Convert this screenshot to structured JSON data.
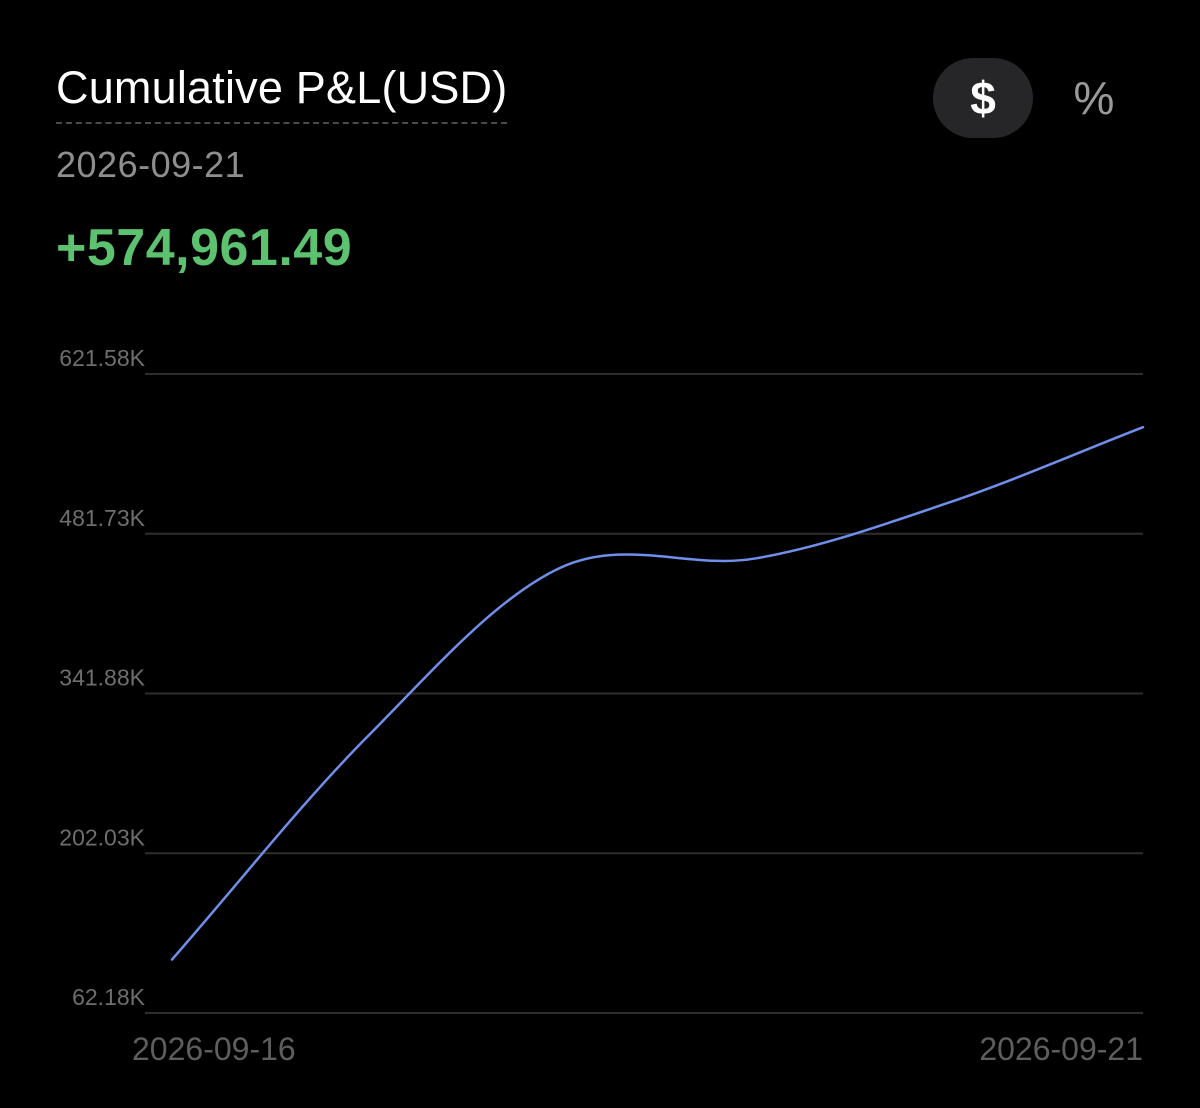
{
  "header": {
    "title": "Cumulative P&L(USD)",
    "toggle_dollar": "$",
    "toggle_percent": "%",
    "selected_date": "2026-09-21",
    "selected_value": "+574,961.49"
  },
  "colors": {
    "background": "#000000",
    "line": "#6f8fea",
    "positive": "#5cc26f",
    "grid": "#2e2e30"
  },
  "chart_data": {
    "type": "line",
    "ylim": [
      62.18,
      621.58
    ],
    "y_unit": "K",
    "y_ticks": [
      "621.58K",
      "481.73K",
      "341.88K",
      "202.03K",
      "62.18K"
    ],
    "x_tick_labels": [
      "2026-09-16",
      "2026-09-21"
    ],
    "x_range": [
      "2026-09-16",
      "2026-09-21"
    ],
    "grid": true,
    "series": [
      {
        "values": [
          {
            "x": "2026-09-16",
            "y": 109
          },
          {
            "x": "2026-09-17",
            "y": 303
          },
          {
            "x": "2026-09-18",
            "y": 452
          },
          {
            "x": "2026-09-19",
            "y": 460
          },
          {
            "x": "2026-09-20",
            "y": 509
          },
          {
            "x": "2026-09-21",
            "y": 575
          }
        ]
      }
    ]
  }
}
